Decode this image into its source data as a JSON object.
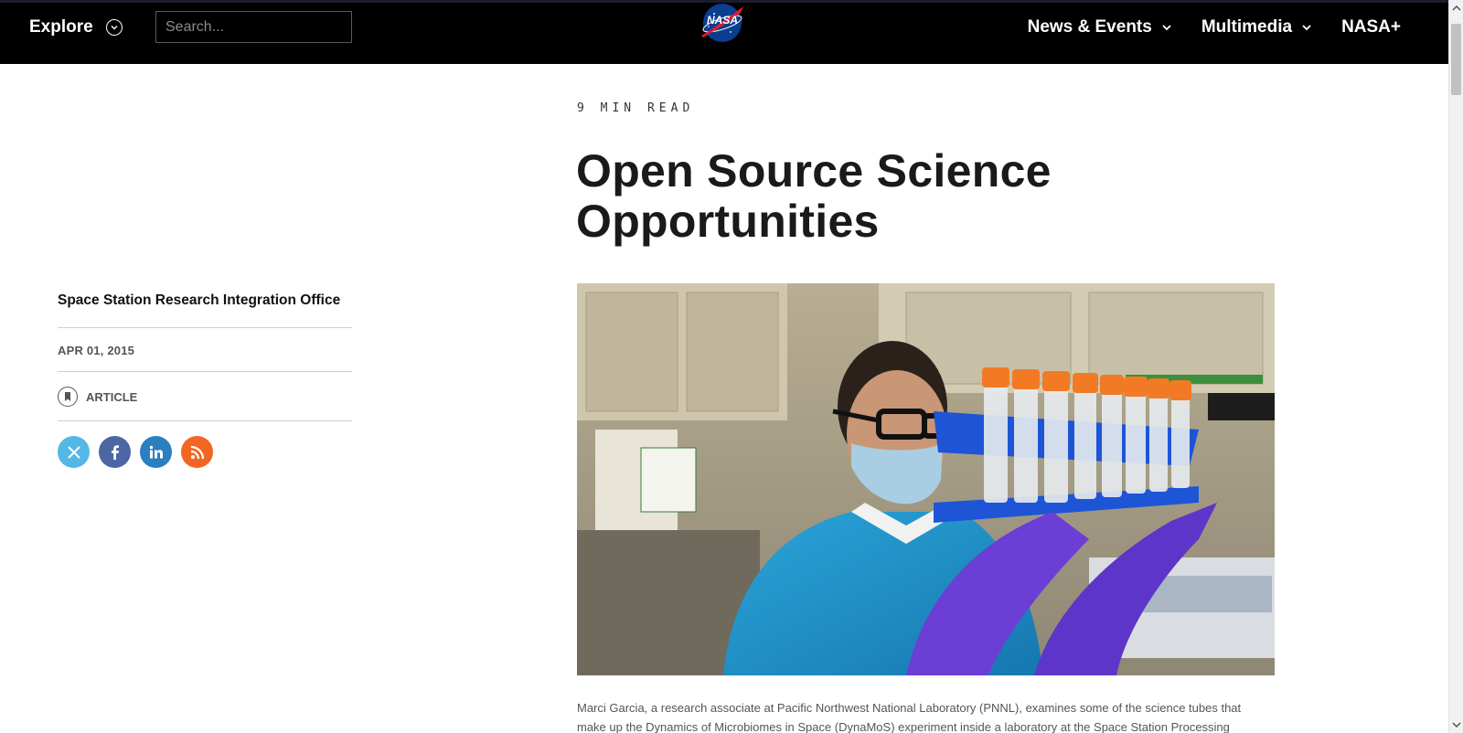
{
  "header": {
    "explore_label": "Explore",
    "search_placeholder": "Search...",
    "logo_text": "NASA",
    "nav": [
      {
        "label": "News & Events"
      },
      {
        "label": "Multimedia"
      },
      {
        "label": "NASA+"
      }
    ]
  },
  "article": {
    "read_time": "9 MIN READ",
    "title_line1": "Open Source Science",
    "title_line2": "Opportunities",
    "office": "Space Station Research Integration Office",
    "date": "APR 01, 2015",
    "type": "ARTICLE",
    "caption": "Marci Garcia, a research associate at Pacific Northwest National Laboratory (PNNL), examines some of the science tubes that make up the Dynamics of Microbiomes in Space (DynaMoS) experiment inside a laboratory at the Space Station Processing"
  },
  "social": [
    {
      "name": "x-icon",
      "color": "#55b7e6"
    },
    {
      "name": "facebook-icon",
      "color": "#4d66a4"
    },
    {
      "name": "linkedin-icon",
      "color": "#2a7fbf"
    },
    {
      "name": "rss-icon",
      "color": "#f26522"
    }
  ],
  "colors": {
    "header_bg": "#000000",
    "accent_red": "#e21d2a",
    "meatball_blue": "#0b3d91"
  }
}
